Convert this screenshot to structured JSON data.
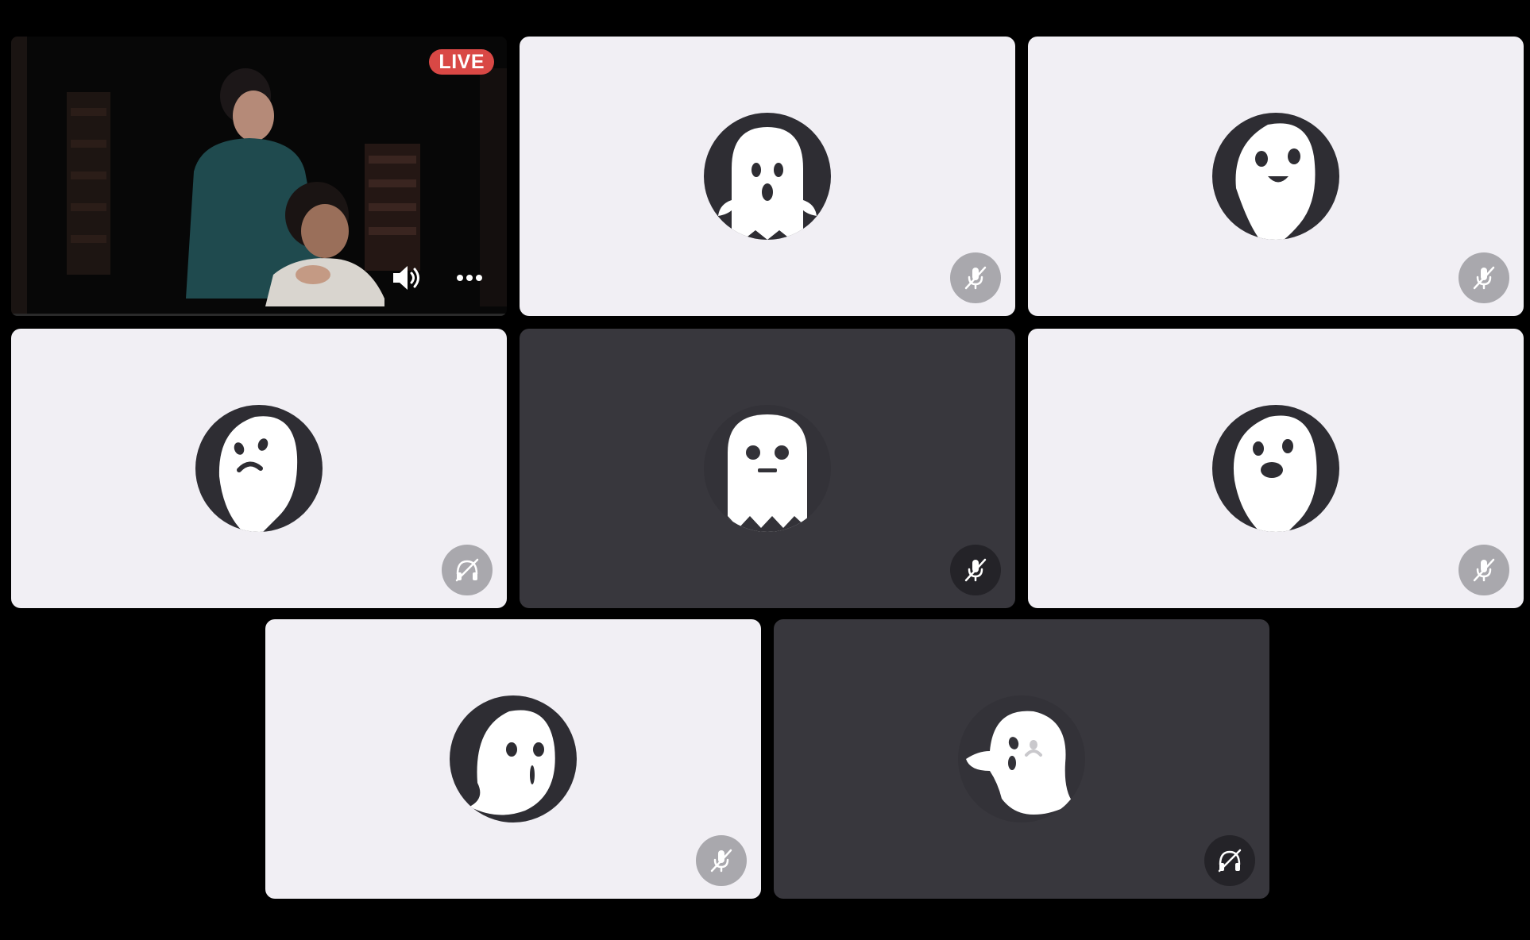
{
  "stream": {
    "live_label": "LIVE",
    "volume_icon": "speaker-icon",
    "more_icon": "more-icon"
  },
  "participants": [
    {
      "tile": "t-2",
      "theme": "light",
      "avatar": "ghost-surprised",
      "status_icon": "mic-off-icon"
    },
    {
      "tile": "t-3",
      "theme": "light",
      "avatar": "ghost-smiling",
      "status_icon": "mic-off-icon"
    },
    {
      "tile": "t-4",
      "theme": "light",
      "avatar": "ghost-sad",
      "status_icon": "deafened-icon"
    },
    {
      "tile": "t-5",
      "theme": "dark",
      "avatar": "ghost-neutral",
      "status_icon": "mic-off-icon"
    },
    {
      "tile": "t-6",
      "theme": "light",
      "avatar": "ghost-shocked",
      "status_icon": "mic-off-icon"
    },
    {
      "tile": "t-7",
      "theme": "light",
      "avatar": "ghost-worried",
      "status_icon": "mic-off-icon"
    },
    {
      "tile": "t-8",
      "theme": "dark",
      "avatar": "ghost-crying",
      "status_icon": "deafened-icon"
    }
  ],
  "colors": {
    "background": "#000000",
    "tile_light": "#f1eff4",
    "tile_dark": "#38373d",
    "live_red": "#d94845",
    "avatar_bg": "#2e2d33",
    "badge_light": "#a9a8ad",
    "badge_dark": "#242328"
  }
}
